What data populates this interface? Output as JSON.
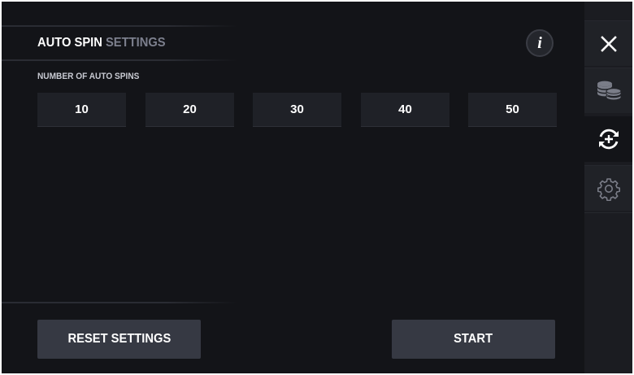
{
  "panel": {
    "title_primary": "AUTO SPIN",
    "title_secondary": "SETTINGS",
    "info_icon": "info-icon",
    "section_label": "NUMBER OF AUTO SPINS",
    "options": [
      "10",
      "20",
      "30",
      "40",
      "50"
    ],
    "reset_label": "RESET SETTINGS",
    "start_label": "START"
  },
  "sidebar": {
    "items": [
      {
        "icon": "close-icon"
      },
      {
        "icon": "coins-icon"
      },
      {
        "icon": "autospin-icon",
        "active": true
      },
      {
        "icon": "gear-icon"
      }
    ]
  },
  "colors": {
    "background": "#131418",
    "button": "#363943",
    "option": "#1f2127",
    "sidebar": "#1b1c21",
    "title_secondary": "#7c7f8d"
  }
}
